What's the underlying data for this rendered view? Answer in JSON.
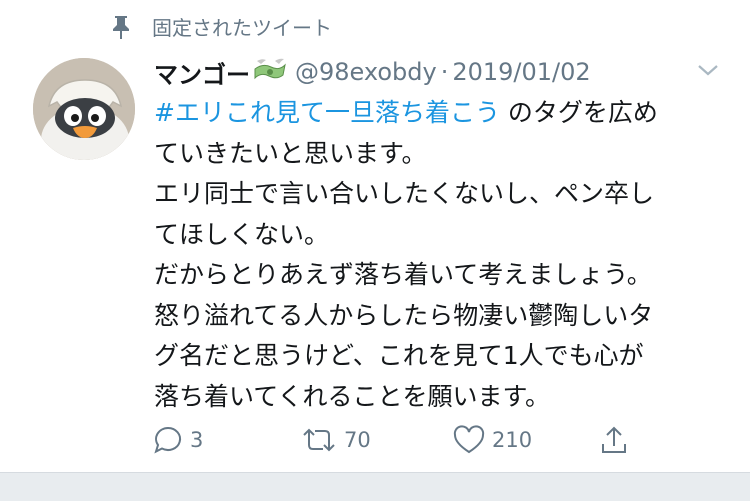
{
  "pinned": {
    "label": "固定されたツイート",
    "icon": "pin-icon"
  },
  "author": {
    "name": "マンゴー",
    "emoji_icon": "money-with-wings-icon",
    "handle": "@98exobdy",
    "separator": "·",
    "date": "2019/01/02"
  },
  "tweet": {
    "hashtag": "#エリこれ見て一旦落ち着こう",
    "line1_rest": " のタグを広め",
    "lines": [
      "ていきたいと思います。",
      "エリ同士で言い合いしたくないし、ペン卒し",
      "てほしくない。",
      "だからとりあえず落ち着いて考えましょう。",
      "怒り溢れてる人からしたら物凄い鬱陶しいタ",
      "グ名だと思うけど、これを見て1人でも心が",
      "落ち着いてくれることを願います。"
    ]
  },
  "actions": {
    "reply": {
      "count": "3",
      "icon": "reply-icon"
    },
    "retweet": {
      "count": "70",
      "icon": "retweet-icon"
    },
    "like": {
      "count": "210",
      "icon": "heart-icon"
    },
    "share": {
      "icon": "share-icon"
    }
  },
  "colors": {
    "link": "#1b95e0",
    "muted": "#657786",
    "text": "#14171a"
  }
}
